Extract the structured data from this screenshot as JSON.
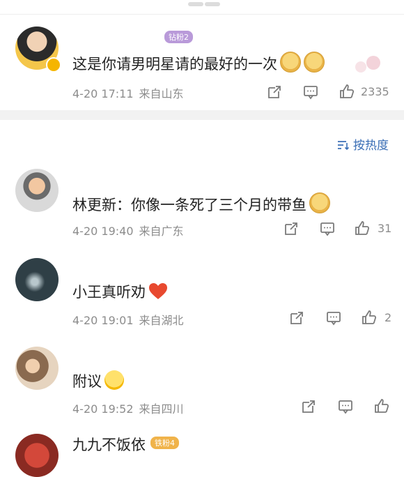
{
  "sort": {
    "label": "按热度"
  },
  "comments": [
    {
      "badge": "钻粉2",
      "text": "这是你请男明星请的最好的一次",
      "date": "4-20 17:11",
      "location": "来自山东",
      "likes": "2335",
      "emoji": [
        "doge",
        "doge"
      ]
    },
    {
      "text": "林更新：你像一条死了三个月的带鱼",
      "date": "4-20 19:40",
      "location": "来自广东",
      "likes": "31",
      "emoji": [
        "doge"
      ]
    },
    {
      "text": "小王真听劝",
      "date": "4-20 19:01",
      "location": "来自湖北",
      "likes": "2",
      "emoji": [
        "heart"
      ]
    },
    {
      "text": "附议",
      "date": "4-20 19:52",
      "location": "来自四川",
      "likes": "",
      "emoji": [
        "laugh"
      ]
    },
    {
      "text": "九九不饭依",
      "badge": "铁粉4",
      "date": "",
      "location": "",
      "likes": ""
    }
  ],
  "colors": {
    "link": "#3b6fb6",
    "meta": "#8c8c8c",
    "badge": "#b99ad9"
  }
}
